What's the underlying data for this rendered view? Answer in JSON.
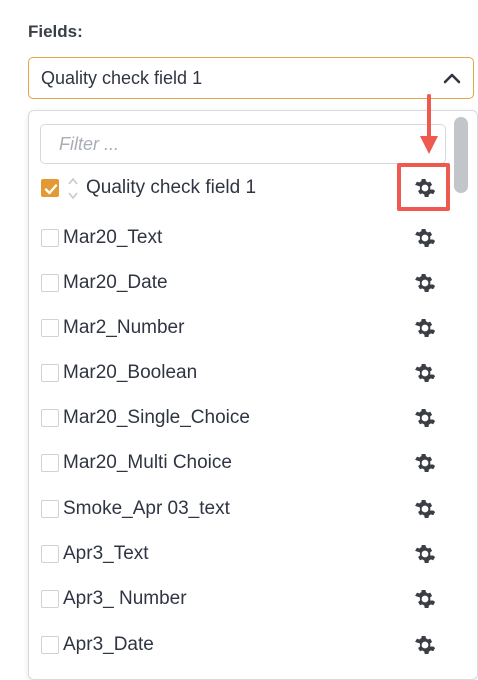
{
  "fields_label": "Fields:",
  "select": {
    "value": "Quality check field 1"
  },
  "filter": {
    "placeholder": "Filter ..."
  },
  "items": [
    {
      "label": "Quality check field 1",
      "checked": true
    },
    {
      "label": "Mar20_Text",
      "checked": false
    },
    {
      "label": "Mar20_Date",
      "checked": false
    },
    {
      "label": "Mar2_Number",
      "checked": false
    },
    {
      "label": "Mar20_Boolean",
      "checked": false
    },
    {
      "label": "Mar20_Single_Choice",
      "checked": false
    },
    {
      "label": "Mar20_Multi Choice",
      "checked": false
    },
    {
      "label": "Smoke_Apr 03_text",
      "checked": false
    },
    {
      "label": "Apr3_Text",
      "checked": false
    },
    {
      "label": "Apr3_ Number",
      "checked": false
    },
    {
      "label": "Apr3_Date",
      "checked": false
    }
  ],
  "icons": {
    "chevron": "chevron-up-icon",
    "gear": "gear-icon",
    "check": "check-icon",
    "reorder": "up-down-icon",
    "annotation_arrow": "arrow-down-icon"
  },
  "colors": {
    "accent": "#e39a34",
    "select_border": "#e0a64a",
    "annotation": "#ee5a4f",
    "text": "#2f3542",
    "gear": "#3b3f45"
  }
}
